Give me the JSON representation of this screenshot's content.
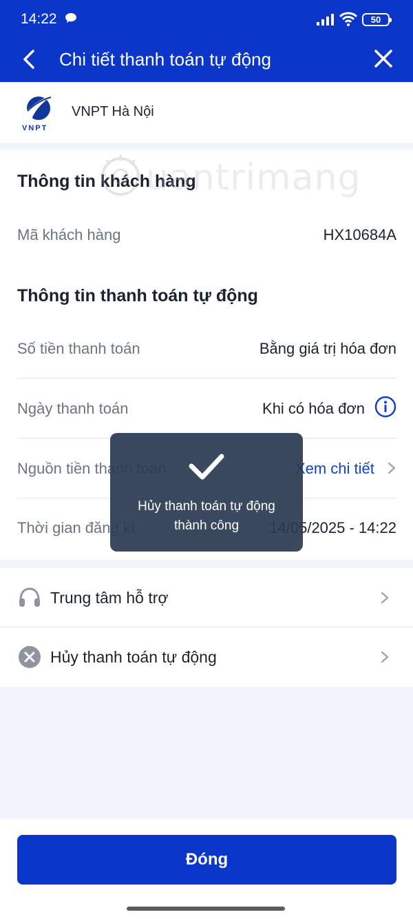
{
  "status_bar": {
    "time": "14:22",
    "battery": "50"
  },
  "header": {
    "title": "Chi tiết thanh toán tự động"
  },
  "provider": {
    "logo_text": "VNPT",
    "name": "VNPT Hà Nội"
  },
  "watermark": {
    "text": "uantrimang"
  },
  "customer_section": {
    "title": "Thông tin khách hàng",
    "rows": [
      {
        "label": "Mã khách hàng",
        "value": "HX10684A"
      }
    ]
  },
  "payment_section": {
    "title": "Thông tin thanh toán tự động",
    "rows": [
      {
        "label": "Số tiền thanh toán",
        "value": "Bằng giá trị hóa đơn"
      },
      {
        "label": "Ngày thanh toán",
        "value": "Khi có hóa đơn",
        "icon": "info-icon"
      },
      {
        "label": "Nguồn tiền thanh toán",
        "value": "Xem chi tiết",
        "icon": "chevron-right-icon"
      },
      {
        "label": "Thời gian đăng kí",
        "value": "14/05/2025 - 14:22"
      }
    ]
  },
  "menu": {
    "items": [
      {
        "label": "Trung tâm hỗ trợ",
        "icon": "headset-icon"
      },
      {
        "label": "Hủy thanh toán tự động",
        "icon": "cancel-circle-icon"
      }
    ]
  },
  "toast": {
    "line1": "Hủy thanh toán tự động",
    "line2": "thành công",
    "icon": "checkmark-icon"
  },
  "footer": {
    "close_label": "Đóng"
  },
  "colors": {
    "brand_blue": "#0c36c9",
    "link_blue": "#1043c6",
    "toast_bg": "#293a51"
  }
}
